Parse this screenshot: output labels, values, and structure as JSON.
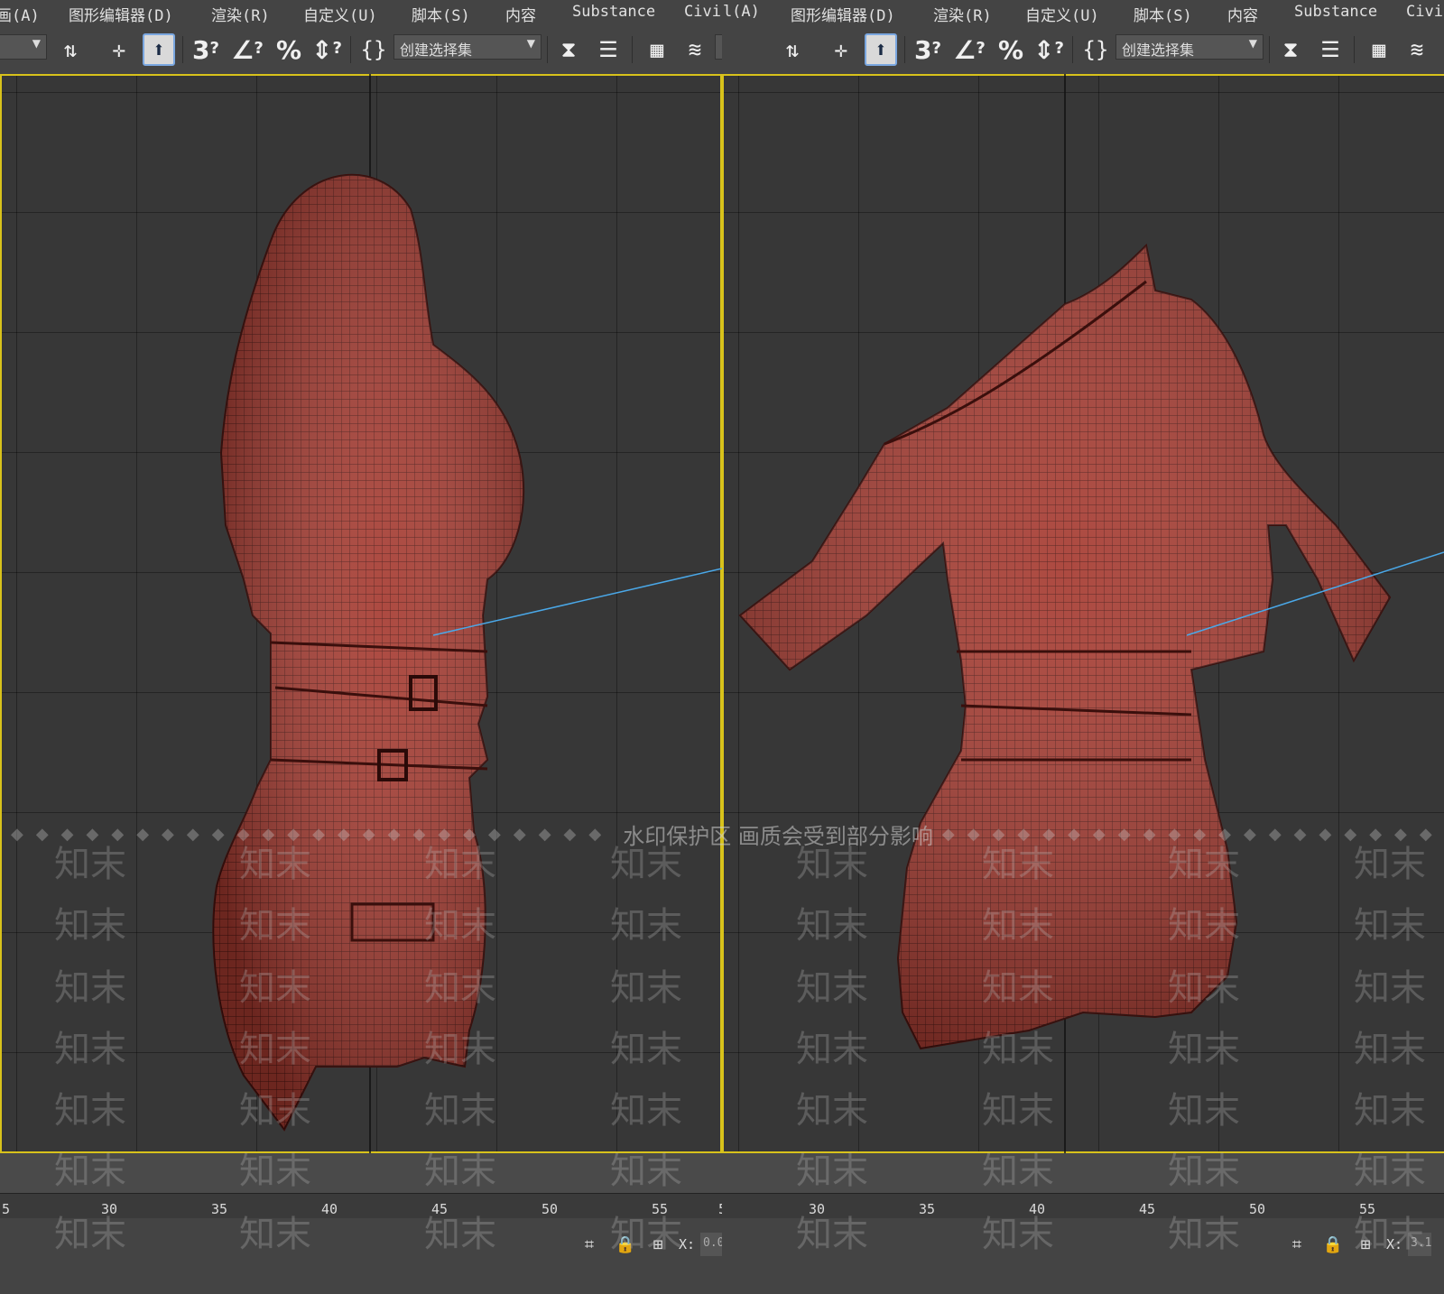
{
  "menu": {
    "items": [
      "画(A)",
      "图形编辑器(D)",
      "渲染(R)",
      "自定义(U)",
      "脚本(S)",
      "内容",
      "Substance",
      "Civil(A)"
    ]
  },
  "toolbar": {
    "selection_set_placeholder": "创建选择集",
    "snap_3d_label": "3",
    "angle_snap_label": "∠",
    "percent_snap_label": "%",
    "spinner_snap_label": "⇕"
  },
  "timeline": {
    "ticks": [
      "5",
      "30",
      "35",
      "40",
      "45",
      "50",
      "55",
      "5"
    ]
  },
  "status": {
    "x_label": "X:",
    "x_value_left": "0.0",
    "x_value_right": "3.1"
  },
  "watermark": {
    "notice": "水印保护区  画质会受到部分影响",
    "tile_text": "知末"
  },
  "colors": {
    "accent_active_border": "#d8c21b",
    "mesh_fill": "#a63a30",
    "mesh_wire": "#4a1410",
    "axis_line": "#4aa8e8"
  }
}
